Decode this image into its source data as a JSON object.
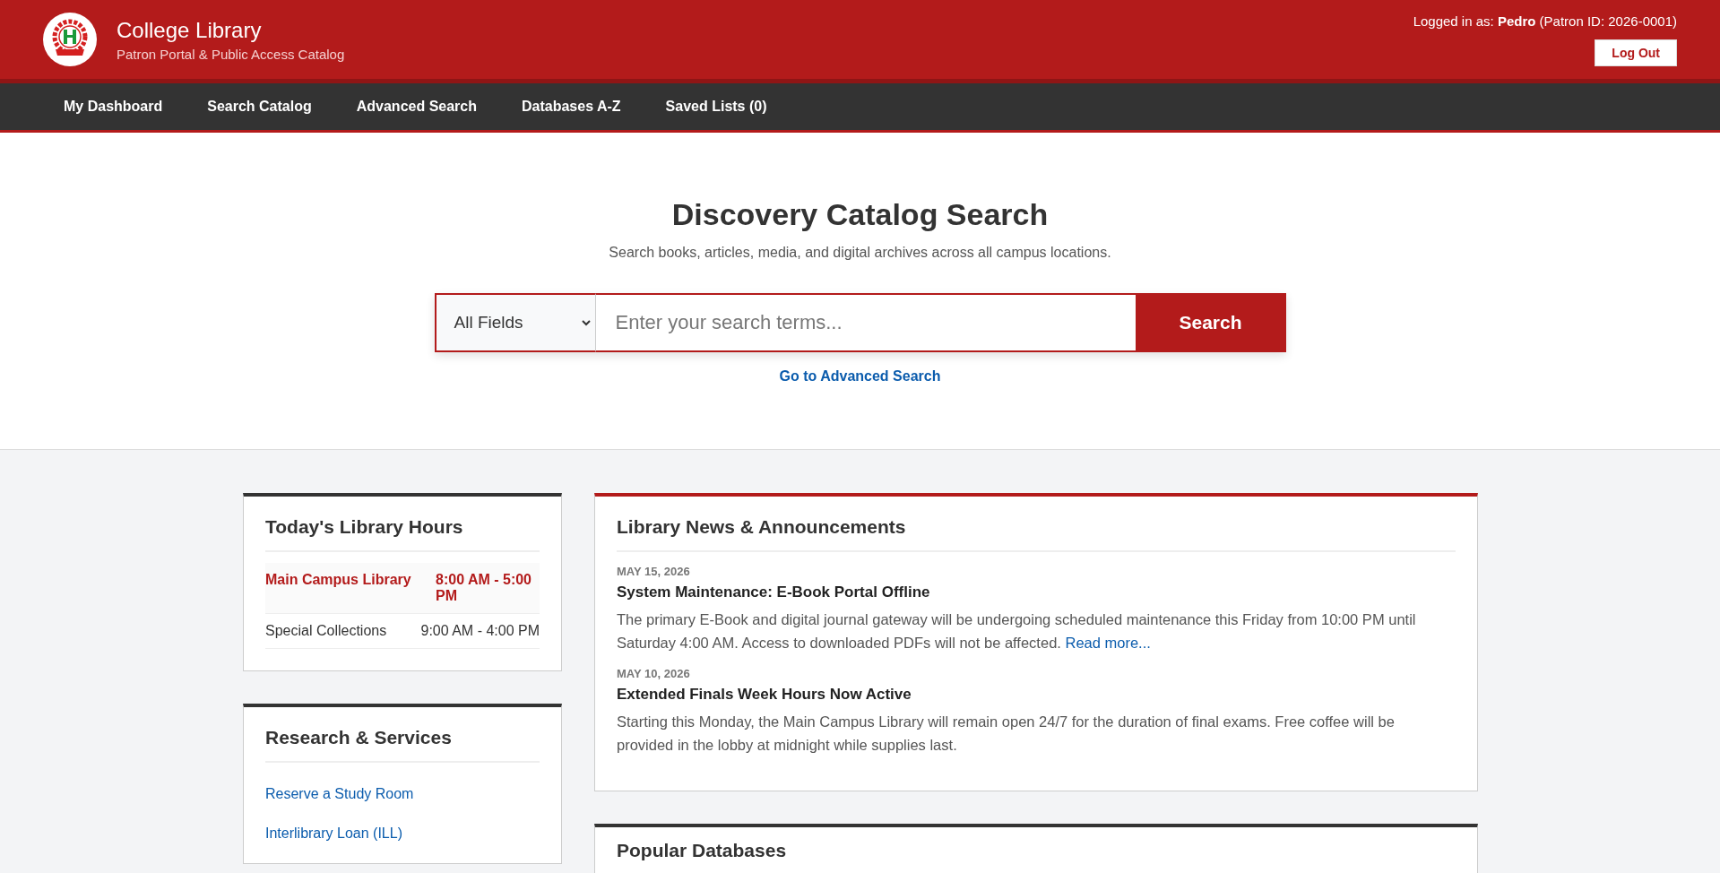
{
  "header": {
    "title": "College Library",
    "subtitle": "Patron Portal & Public Access Catalog",
    "login_text": "Logged in as: **Pedro** (Patron ID: 2026-0001)",
    "logout_button": "Log Out"
  },
  "nav": [
    {
      "label": "My Dashboard",
      "selected": false
    },
    {
      "label": "Search Catalog",
      "selected": false
    },
    {
      "label": "Advanced Search",
      "selected": false
    },
    {
      "label": "Databases A-Z",
      "selected": false
    },
    {
      "label": "Saved Lists (0)",
      "selected": false
    }
  ],
  "hero": {
    "title": "Discovery Catalog Search",
    "subtitle": "Search books, articles, media, and digital archives across all campus locations.",
    "field_select": "All Fields",
    "search_placeholder": "Enter your search terms...",
    "search_button": "Search",
    "advanced_link": "Go to Advanced Search"
  },
  "hours": {
    "title": "Today's Library Hours",
    "rows": [
      {
        "location": "Main Campus Library",
        "hours": "8:00 AM - 5:00 PM",
        "current": true
      },
      {
        "location": "Special Collections",
        "hours": "9:00 AM - 4:00 PM",
        "current": false
      }
    ]
  },
  "services": {
    "title": "Research & Services",
    "links": [
      "Reserve a Study Room",
      "Interlibrary Loan (ILL)"
    ]
  },
  "news": {
    "title": "Library News & Announcements",
    "items": [
      {
        "date": "MAY 15, 2026",
        "headline": "System Maintenance: E-Book Portal Offline",
        "body": "The primary E-Book and digital journal gateway will be undergoing scheduled maintenance this Friday from 10:00 PM until Saturday 4:00 AM. Access to downloaded PDFs will not be affected.",
        "link": "Read more..."
      },
      {
        "date": "MAY 10, 2026",
        "headline": "Extended Finals Week Hours Now Active",
        "body": "Starting this Monday, the Main Campus Library will remain open 24/7 for the duration of final exams. Free coffee will be provided in the lobby at midnight while supplies last."
      }
    ]
  },
  "databases": {
    "title": "Popular Databases"
  }
}
